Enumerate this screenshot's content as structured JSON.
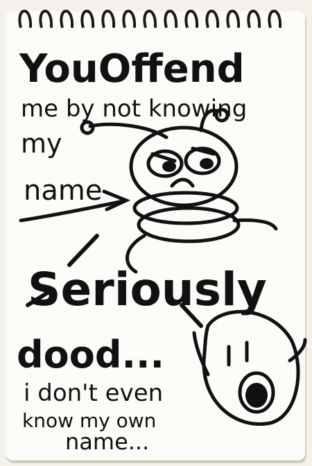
{
  "doodle": {
    "line1": "YouOffend",
    "line2": "me by not knowing",
    "line3": "my",
    "line4": "name",
    "line5": "Seriously",
    "line6": "dood...",
    "line7": "i don't even",
    "line8": "know my own",
    "line9": "name..."
  },
  "colors": {
    "ink": "#111111",
    "paper": "#fbfbf8",
    "ring": "#1a1a1a"
  }
}
